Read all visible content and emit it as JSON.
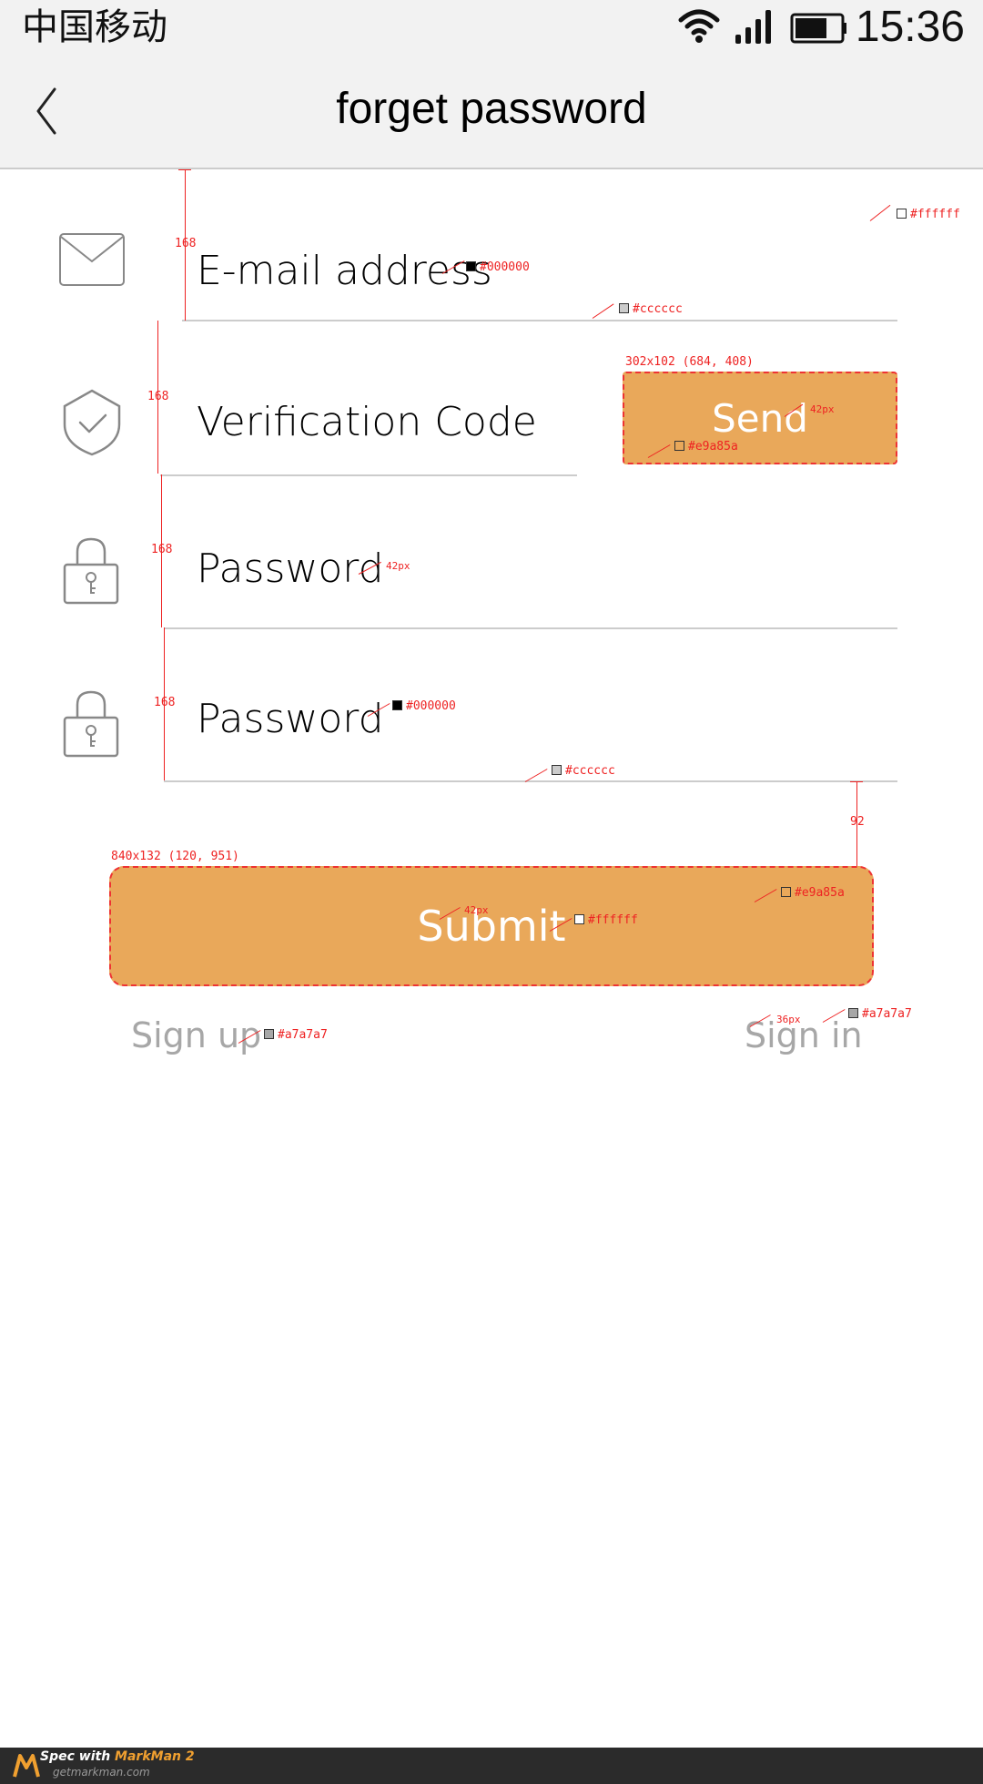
{
  "status_bar": {
    "carrier": "中国移动",
    "time": "15:36",
    "icons": [
      "wifi-icon",
      "signal-icon",
      "battery-icon"
    ]
  },
  "nav": {
    "back_icon": "chevron-left-icon",
    "title": "forget password"
  },
  "form": {
    "email": {
      "icon": "mail-icon",
      "label": "E-mail address"
    },
    "code": {
      "icon": "shield-check-icon",
      "label": "Verification Code",
      "send_label": "Send"
    },
    "password": {
      "icon": "lock-icon",
      "label": "Password"
    },
    "confirm_password": {
      "icon": "lock-icon",
      "label": "Password"
    },
    "submit_label": "Submit"
  },
  "links": {
    "sign_up": "Sign up",
    "sign_in": "Sign in"
  },
  "colors": {
    "accent": "#e9a85a",
    "text": "#000000",
    "divider": "#cccccc",
    "link": "#a7a7a7",
    "background": "#ffffff",
    "button_text": "#ffffff"
  },
  "annotations": {
    "spacing_168": "168",
    "spacing_92": "92",
    "send_spec": "302x102 (684, 408)",
    "submit_spec": "840x132 (120, 951)",
    "font_42": "42px",
    "font_36": "36px",
    "color_white": "#ffffff",
    "color_black": "#000000",
    "color_divider": "#cccccc",
    "color_accent": "#e9a85a",
    "color_link": "#a7a7a7"
  },
  "footer": {
    "spec_prefix": "Spec with ",
    "brand": "MarkMan 2",
    "site": "getmarkman.com"
  }
}
